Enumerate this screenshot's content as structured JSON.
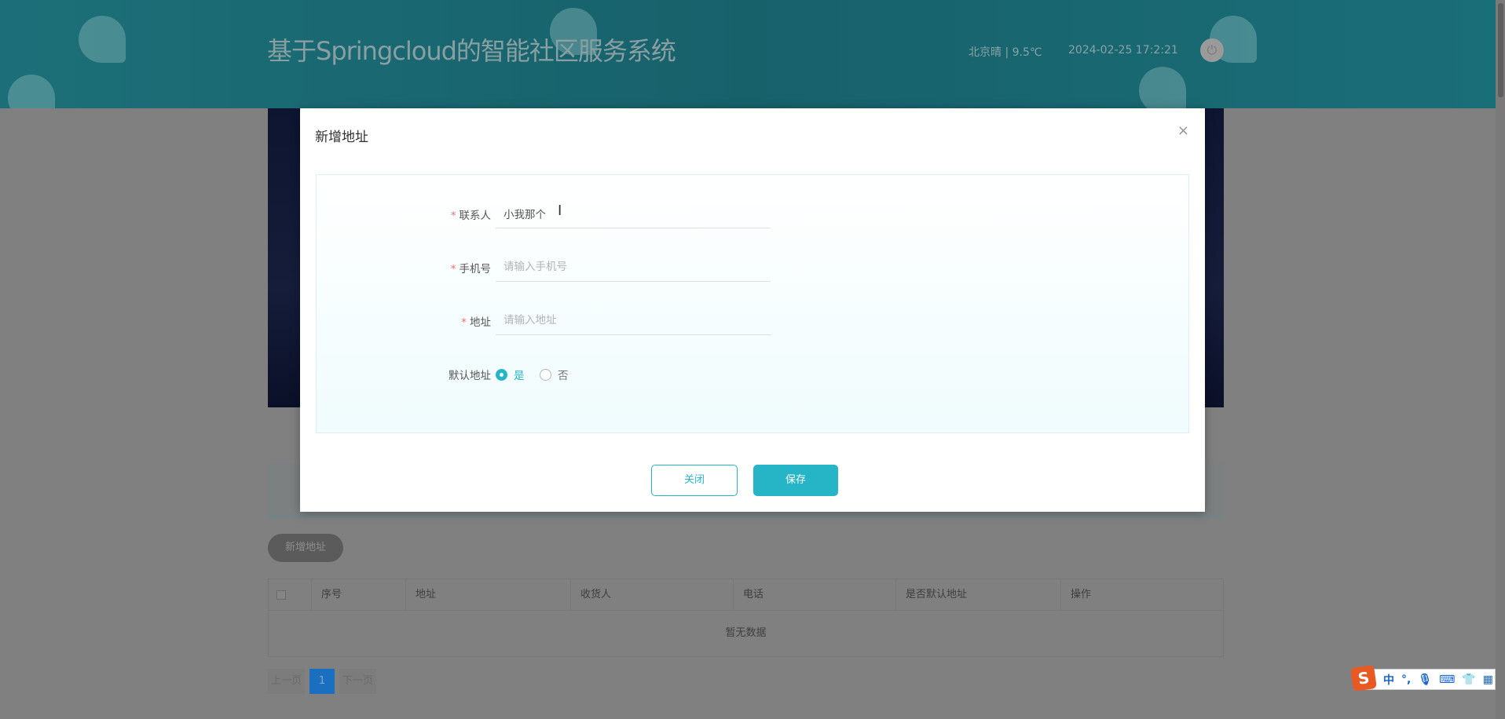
{
  "header": {
    "title": "基于Springcloud的智能社区服务系统",
    "weather": "北京晴 | 9.5℃",
    "date": "2024-02-25  17:2:21",
    "power_icon": "power-icon"
  },
  "page": {
    "add_button": "新增地址",
    "table": {
      "columns": [
        "序号",
        "地址",
        "收货人",
        "电话",
        "是否默认地址",
        "操作"
      ],
      "empty": "暂无数据"
    },
    "pagination": {
      "prev": "上一页",
      "current": "1",
      "next": "下一页"
    }
  },
  "modal": {
    "title": "新增地址",
    "close": "×",
    "fields": {
      "contact": {
        "label": "联系人",
        "value": "小我那个",
        "required": "*"
      },
      "phone": {
        "label": "手机号",
        "placeholder": "请输入手机号",
        "required": "*"
      },
      "address": {
        "label": "地址",
        "placeholder": "请输入地址",
        "required": "*"
      },
      "default": {
        "label": "默认地址",
        "options": [
          "是",
          "否"
        ],
        "selected": "是"
      }
    },
    "buttons": {
      "close": "关闭",
      "save": "保存"
    }
  },
  "ime": {
    "logo": "S",
    "mode": "中",
    "punct": "°,"
  },
  "colors": {
    "accent": "#26b5c6",
    "header": "#17616b",
    "required": "#f56c6c"
  }
}
